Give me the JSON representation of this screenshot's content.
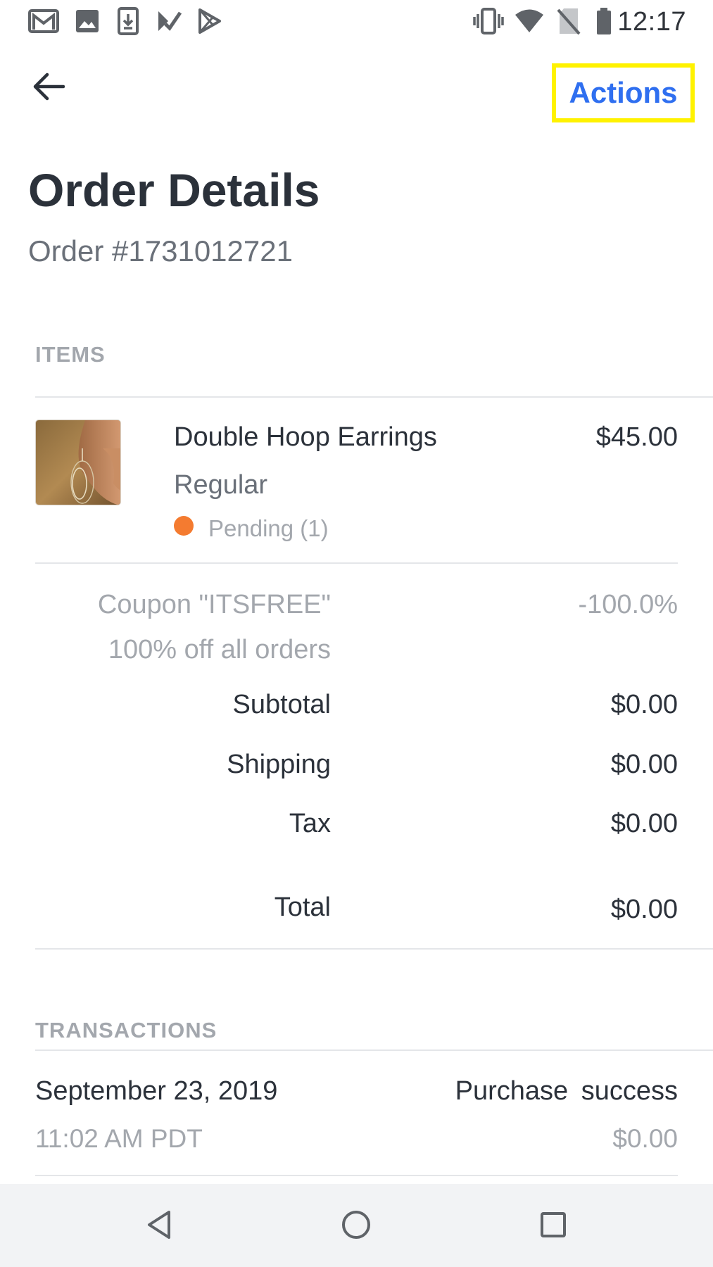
{
  "status_bar": {
    "time": "12:17",
    "left_icons": [
      "gmail-icon",
      "image-icon",
      "download-icon",
      "tasks-icon",
      "play-store-icon"
    ],
    "right_icons": [
      "vibrate-icon",
      "wifi-icon",
      "no-sim-icon",
      "battery-icon"
    ]
  },
  "app_bar": {
    "back_icon": "arrow-back-icon",
    "actions_label": "Actions",
    "actions_highlight_color": "#fff200",
    "actions_text_color": "#2f6ff0"
  },
  "header": {
    "title": "Order Details",
    "order_number": "Order #1731012721"
  },
  "items_section": {
    "heading": "ITEMS",
    "items": [
      {
        "name": "Double Hoop Earrings",
        "variant": "Regular",
        "status": "Pending (1)",
        "status_color": "#f47b30",
        "price": "$45.00"
      }
    ]
  },
  "summary": {
    "coupon_label": "Coupon \"ITSFREE\"",
    "coupon_description": "100% off all orders",
    "coupon_value": "-100.0%",
    "subtotal_label": "Subtotal",
    "subtotal_value": "$0.00",
    "shipping_label": "Shipping",
    "shipping_value": "$0.00",
    "tax_label": "Tax",
    "tax_value": "$0.00",
    "total_label": "Total",
    "total_value": "$0.00"
  },
  "transactions_section": {
    "heading": "TRANSACTIONS",
    "transactions": [
      {
        "date": "September 23, 2019",
        "time": "11:02 AM PDT",
        "type": "Purchase success",
        "amount": "$0.00"
      }
    ]
  },
  "nav_bar": {
    "buttons": [
      "nav-back-icon",
      "nav-home-icon",
      "nav-recents-icon"
    ]
  }
}
